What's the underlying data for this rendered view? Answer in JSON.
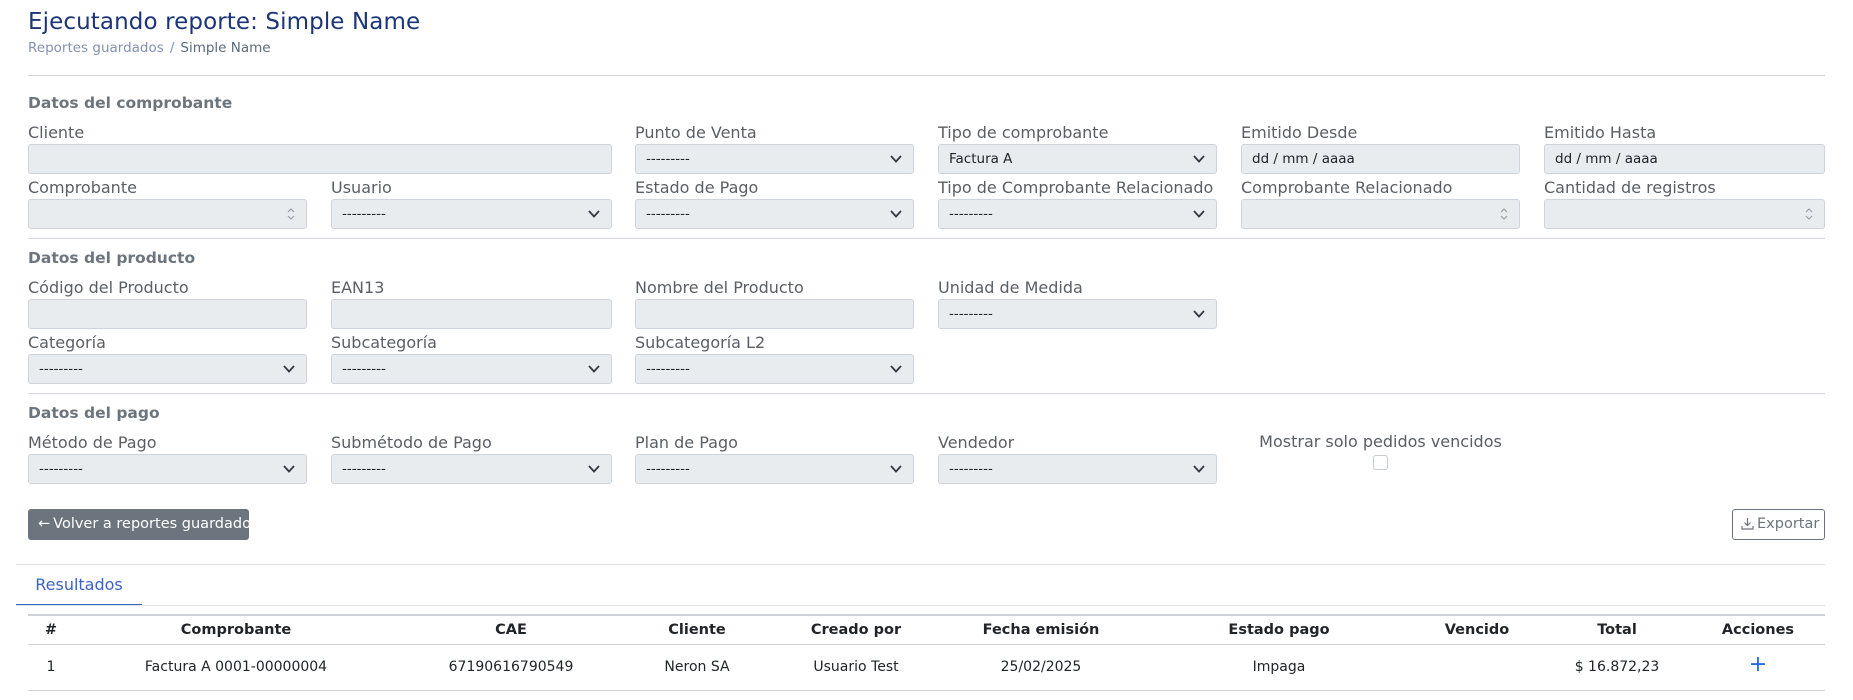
{
  "header": {
    "title": "Ejecutando reporte: Simple Name",
    "breadcrumb": {
      "parent": "Reportes guardados",
      "separator": "/",
      "current": "Simple Name"
    }
  },
  "sections": {
    "comprobante": {
      "title": "Datos del comprobante",
      "fields": {
        "cliente": {
          "label": "Cliente",
          "value": ""
        },
        "punto_venta": {
          "label": "Punto de Venta",
          "value": "---------"
        },
        "tipo_comprobante": {
          "label": "Tipo de comprobante",
          "value": "Factura A"
        },
        "emitido_desde": {
          "label": "Emitido Desde",
          "value": "dd / mm / aaaa"
        },
        "emitido_hasta": {
          "label": "Emitido Hasta",
          "value": "dd / mm / aaaa"
        },
        "comprobante": {
          "label": "Comprobante",
          "value": ""
        },
        "usuario": {
          "label": "Usuario",
          "value": "---------"
        },
        "estado_pago": {
          "label": "Estado de Pago",
          "value": "---------"
        },
        "tipo_comp_relacionado": {
          "label": "Tipo de Comprobante Relacionado",
          "value": "---------"
        },
        "comp_relacionado": {
          "label": "Comprobante Relacionado",
          "value": ""
        },
        "cantidad_registros": {
          "label": "Cantidad de registros",
          "value": ""
        }
      }
    },
    "producto": {
      "title": "Datos del producto",
      "fields": {
        "codigo": {
          "label": "Código del Producto",
          "value": ""
        },
        "ean13": {
          "label": "EAN13",
          "value": ""
        },
        "nombre": {
          "label": "Nombre del Producto",
          "value": ""
        },
        "unidad": {
          "label": "Unidad de Medida",
          "value": "---------"
        },
        "categoria": {
          "label": "Categoría",
          "value": "---------"
        },
        "subcategoria": {
          "label": "Subcategoría",
          "value": "---------"
        },
        "subcategoria_l2": {
          "label": "Subcategoría L2",
          "value": "---------"
        }
      }
    },
    "pago": {
      "title": "Datos del pago",
      "fields": {
        "metodo": {
          "label": "Método de Pago",
          "value": "---------"
        },
        "submetodo": {
          "label": "Submétodo de Pago",
          "value": "---------"
        },
        "plan": {
          "label": "Plan de Pago",
          "value": "---------"
        },
        "vendedor": {
          "label": "Vendedor",
          "value": "---------"
        }
      },
      "vencidos": {
        "label": "Mostrar solo pedidos vencidos",
        "checked": false
      }
    }
  },
  "actions": {
    "back": "Volver a reportes guardados",
    "back_arrow": "←",
    "export": "Exportar"
  },
  "results": {
    "tab": "Resultados",
    "columns": [
      "#",
      "Comprobante",
      "CAE",
      "Cliente",
      "Creado por",
      "Fecha emisión",
      "Estado pago",
      "Vencido",
      "Total",
      "Acciones"
    ],
    "rows": [
      [
        "1",
        "Factura A 0001-00000004",
        "67190616790549",
        "Neron SA",
        "Usuario Test",
        "25/02/2025",
        "Impaga",
        "",
        "$ 16.872,23",
        "+"
      ]
    ]
  },
  "colors": {
    "title": "#1c3578",
    "accent": "#3d62c8",
    "action_icon": "#1e6ae6",
    "secondary_button": "#6c757d",
    "input_bg": "#e9ecef"
  },
  "icons": [
    "chevron-down-icon",
    "spinner-arrows-icon",
    "arrow-left-icon",
    "download-icon",
    "plus-icon"
  ]
}
